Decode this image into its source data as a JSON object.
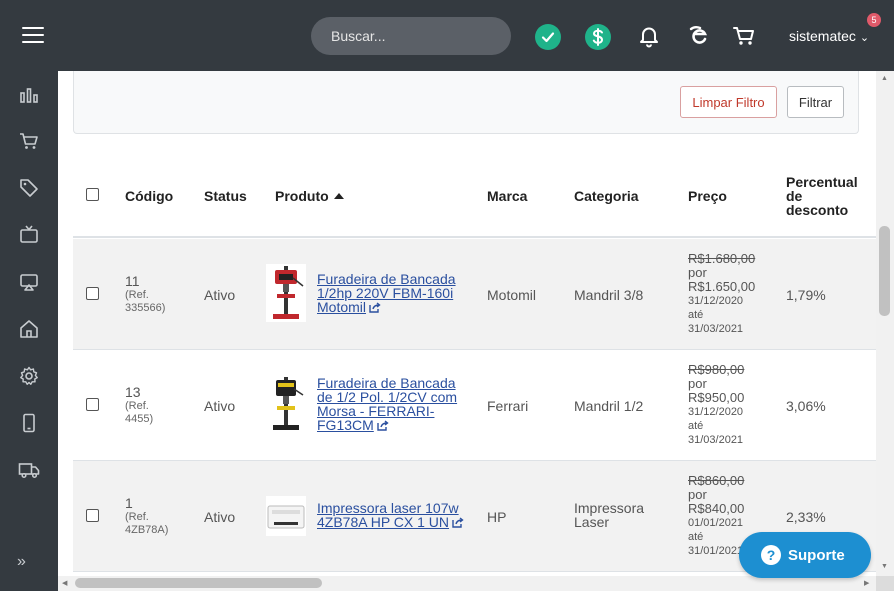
{
  "topbar": {
    "search_placeholder": "Buscar...",
    "user": "sistematec",
    "notifications": "5",
    "icons": [
      "menu-icon",
      "check-icon",
      "dollar-icon",
      "bell-icon",
      "e-icon",
      "cart-icon"
    ]
  },
  "sidebar": {
    "icons": [
      "chart-icon",
      "cart-icon",
      "tag-icon",
      "tv-icon",
      "cast-icon",
      "home-icon",
      "gear-icon",
      "mobile-icon",
      "truck-icon"
    ],
    "expand": "»"
  },
  "filters": {
    "clear_label": "Limpar Filtro",
    "filter_label": "Filtrar"
  },
  "table": {
    "headers": {
      "codigo": "Código",
      "status": "Status",
      "produto": "Produto",
      "marca": "Marca",
      "categoria": "Categoria",
      "preco": "Preço",
      "desconto_1": "Percentual",
      "desconto_2": "de",
      "desconto_3": "desconto"
    },
    "rows": [
      {
        "code": "11",
        "ref_1": "(Ref.",
        "ref_2": "335566)",
        "status": "Ativo",
        "product_1": "Furadeira de Bancada",
        "product_2": "1/2hp 220V FBM-160i",
        "product_3": "Motomil",
        "brand": "Motomil",
        "category_1": "Mandril 3/8",
        "category_2": "",
        "price_old": "R$1.680,00",
        "por": "por",
        "price_new": "R$1.650,00",
        "date_from": "31/12/2020",
        "ate": "até",
        "date_to": "31/03/2021",
        "discount": "1,79%"
      },
      {
        "code": "13",
        "ref_1": "(Ref.",
        "ref_2": "4455)",
        "status": "Ativo",
        "product_1": "Furadeira de Bancada",
        "product_2": "de 1/2 Pol. 1/2CV com",
        "product_3": "Morsa - FERRARI-",
        "product_4": "FG13CM",
        "brand": "Ferrari",
        "category_1": "Mandril 1/2",
        "category_2": "",
        "price_old": "R$980,00",
        "por": "por",
        "price_new": "R$950,00",
        "date_from": "31/12/2020",
        "ate": "até",
        "date_to": "31/03/2021",
        "discount": "3,06%"
      },
      {
        "code": "1",
        "ref_1": "(Ref.",
        "ref_2": "4ZB78A)",
        "status": "Ativo",
        "product_1": "Impressora laser 107w",
        "product_2": "4ZB78A HP CX 1 UN",
        "brand": "HP",
        "category_1": "Impressora",
        "category_2": "Laser",
        "price_old": "R$860,00",
        "por": "por",
        "price_new": "R$840,00",
        "date_from": "01/01/2021",
        "ate": "até",
        "date_to": "31/01/2021",
        "discount": "2,33%"
      }
    ]
  },
  "support": {
    "label": "Suporte",
    "q": "?"
  },
  "colors": {
    "topbar": "#343a40",
    "accent_green": "#1fb38a",
    "support_blue": "#1d8fd1",
    "link_blue": "#2a4f9f"
  }
}
